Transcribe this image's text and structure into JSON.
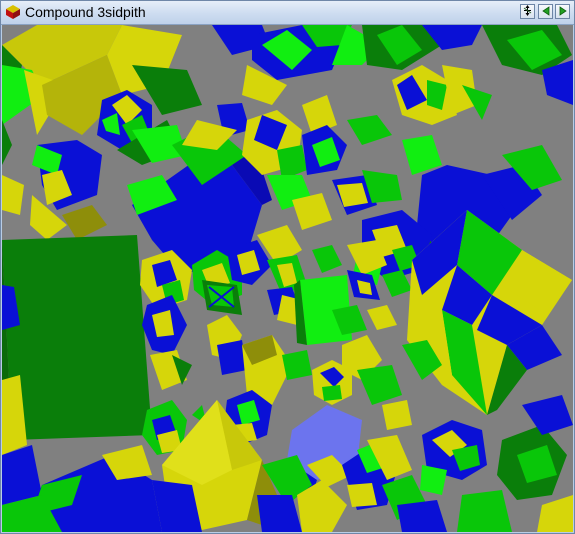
{
  "window": {
    "title": "Compound 3sidpith",
    "icon": "polyhedron-app-icon"
  },
  "toolbar": {
    "buttons": [
      {
        "name": "rotation-axis-button",
        "icon": "axis-arrows-icon"
      },
      {
        "name": "previous-button",
        "icon": "triangle-left-icon"
      },
      {
        "name": "next-button",
        "icon": "triangle-right-icon"
      }
    ]
  },
  "colors": {
    "background": "#808080",
    "blue": "#0a10d6",
    "green": "#09c609",
    "bright_green": "#11ee11",
    "dark_green": "#0a7e0a",
    "yellow": "#d6d60a",
    "olive": "#8e8e0a",
    "light_blue": "#6c74ee"
  }
}
